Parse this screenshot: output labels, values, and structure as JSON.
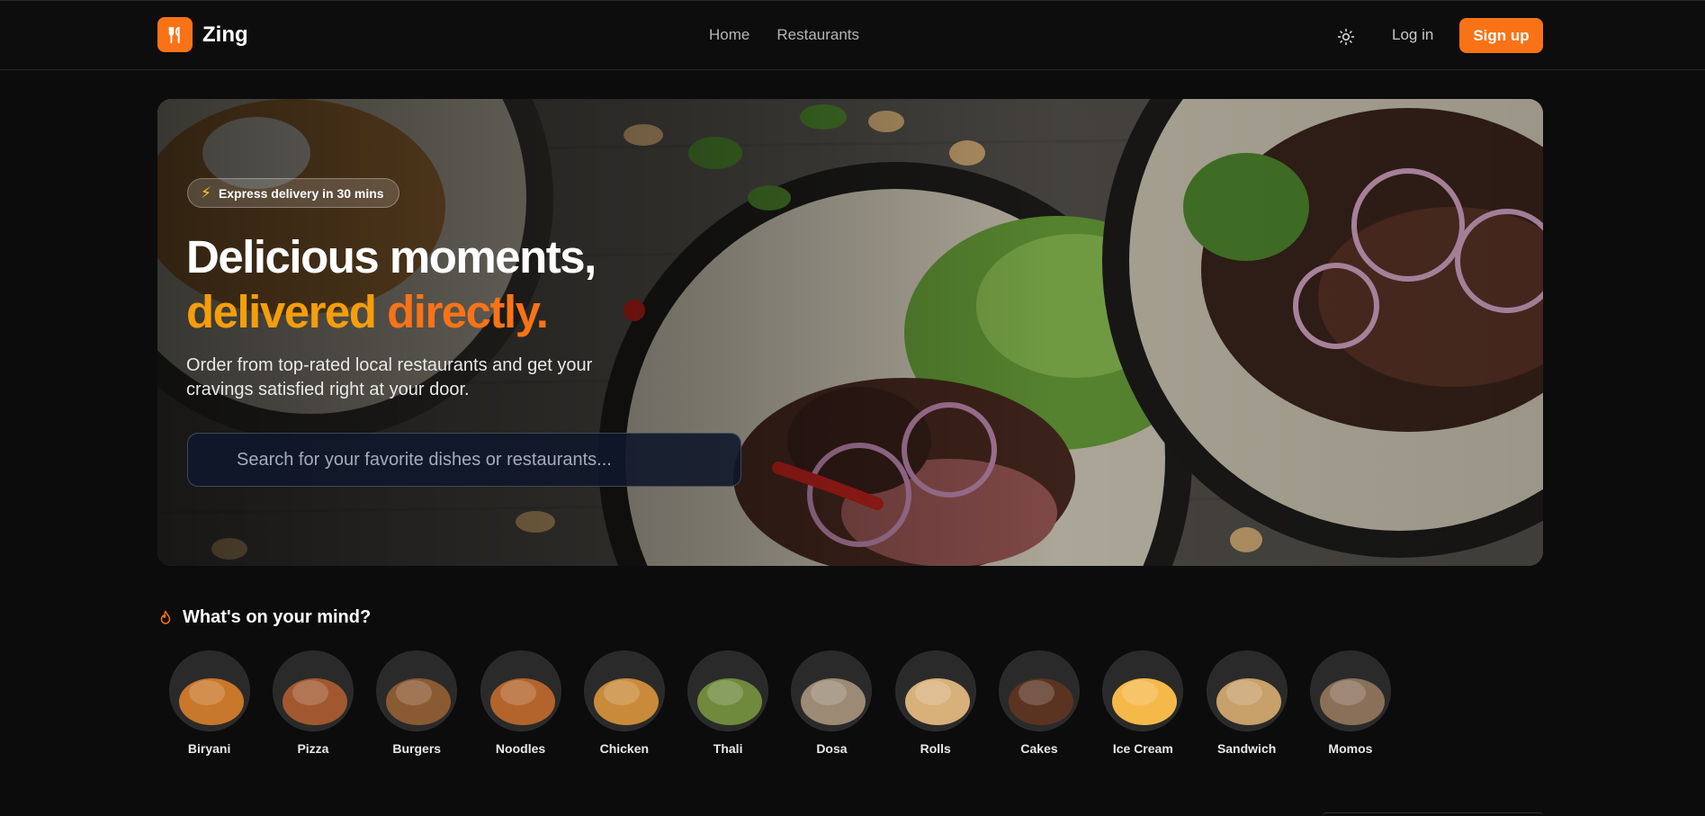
{
  "brand": {
    "name": "Zing",
    "logo_icon": "fork-knife-icon",
    "accent": "#f97316"
  },
  "nav": {
    "items": [
      {
        "label": "Home"
      },
      {
        "label": "Restaurants"
      }
    ]
  },
  "header_actions": {
    "theme_icon": "sun-icon",
    "login_label": "Log in",
    "signup_label": "Sign up"
  },
  "hero": {
    "badge_icon": "lightning-icon",
    "badge_text": "Express delivery in 30 mins",
    "title_line1": "Delicious moments,",
    "title_line2_a": "delivered ",
    "title_line2_b": "directly.",
    "subtitle": "Order from top-rated local restaurants and get your cravings satisfied right at your door.",
    "search_placeholder": "Search for your favorite dishes or restaurants..."
  },
  "categories_section": {
    "icon": "flame-icon",
    "title": "What's on your mind?",
    "items": [
      {
        "label": "Biryani",
        "color": "#c9772a"
      },
      {
        "label": "Pizza",
        "color": "#a2582f"
      },
      {
        "label": "Burgers",
        "color": "#8a5a33"
      },
      {
        "label": "Noodles",
        "color": "#b3642c"
      },
      {
        "label": "Chicken",
        "color": "#c98a3a"
      },
      {
        "label": "Thali",
        "color": "#6f8a3c"
      },
      {
        "label": "Dosa",
        "color": "#9c8a74"
      },
      {
        "label": "Rolls",
        "color": "#d7b07a"
      },
      {
        "label": "Cakes",
        "color": "#5a3421"
      },
      {
        "label": "Ice Cream",
        "color": "#f5b94a"
      },
      {
        "label": "Sandwich",
        "color": "#c7a06a"
      },
      {
        "label": "Momos",
        "color": "#8a7058"
      }
    ]
  }
}
